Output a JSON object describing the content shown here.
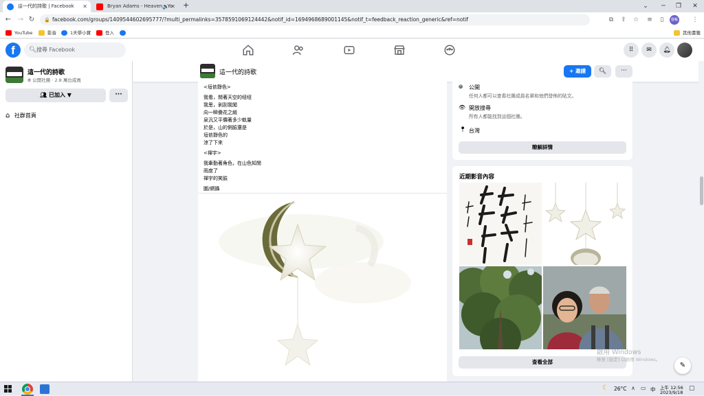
{
  "browser": {
    "tabs": [
      {
        "title": "這一代的詩歌 | Facebook",
        "active": true
      },
      {
        "title": "Bryan Adams - Heaven - Yo",
        "active": false
      }
    ],
    "new_tab": "+",
    "url": "facebook.com/groups/1409544602695777/?multi_permalinks=3578591069124442&notif_id=1694968689001145&notif_t=feedback_reaction_generic&ref=notif",
    "profile_initials": "發帳",
    "bookmarks": [
      "YouTube",
      "影音",
      "1天學小寶",
      "登入"
    ],
    "other_bookmarks": "其他書籤"
  },
  "fb": {
    "logo": "f",
    "search_placeholder": "搜尋 Facebook"
  },
  "group": {
    "name": "這一代的詩歌",
    "meta": "公開社團 · 2.8 萬位成員",
    "joined_label": "已加入",
    "more_label": "···",
    "home_label": "社群首頁",
    "invite_label": "+ 邀請"
  },
  "post": {
    "lines": [
      "<垣依靜色>",
      "",
      "我看，閒著天空的纽纽",
      "我思，剝刮我闖",
      "向一瞬疊花之緞",
      "泉汎又平價著多少軌量",
      "於是，山的側臉還是",
      "垣依靜色的",
      "涼了下來",
      "",
      "<禪宇>",
      "",
      "我牽勤著角色，在山色知閒",
      "雨度了",
      "禪宇的笑臉",
      "",
      "圖/網攝"
    ]
  },
  "about": {
    "public_title": "公開",
    "public_desc": "任何人都可以查看社團成員名單和他們發佈的貼文。",
    "visible_title": "開放搜尋",
    "visible_desc": "所有人都能找到這個社團。",
    "location": "台灣",
    "learn_more": "瞭解詳情"
  },
  "media": {
    "title": "近期影音內容",
    "see_all": "查看全部"
  },
  "watermark": {
    "line1": "啟用 Windows",
    "line2": "移至 [設定] 以啟用 Windows。"
  },
  "taskbar": {
    "temperature": "26°C",
    "ime": "中",
    "time": "上午 12:56",
    "date": "2023/9/18"
  },
  "colors": {
    "fb_blue": "#1877f2",
    "bg": "#f0f2f5"
  }
}
